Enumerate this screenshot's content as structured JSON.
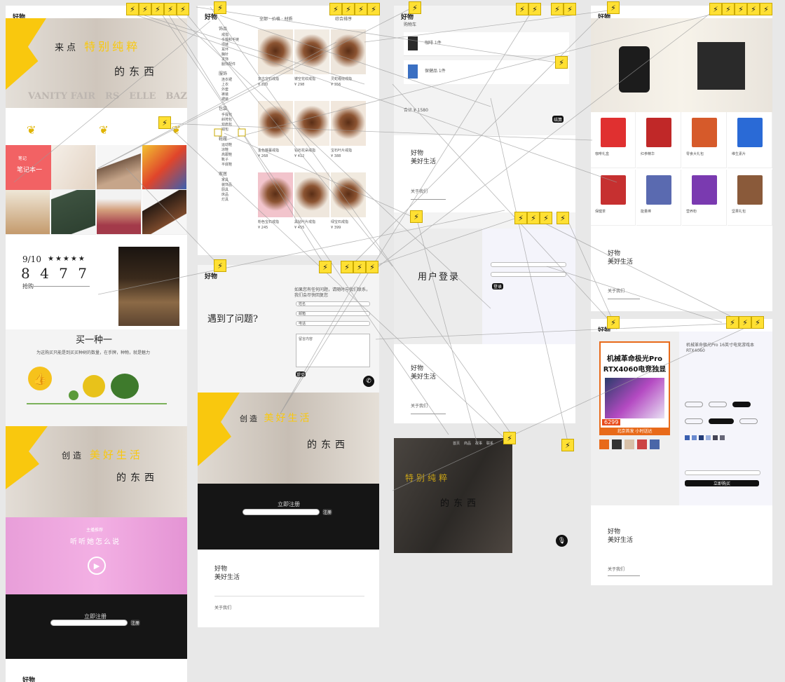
{
  "artboard1": {
    "header": "好物",
    "hero": {
      "line1_a": "来点",
      "line1_b": "特别纯粹",
      "line2": "的东西"
    },
    "brands": [
      "VANITY FAIR",
      "RS",
      "ELLE",
      "BAZAAR"
    ],
    "notebook": {
      "small": "笔记",
      "label": "笔记本一"
    },
    "deal": {
      "date": "9/10",
      "stars": "★★★★★",
      "count": "8 4 7 7",
      "label": "抢购"
    },
    "buy_one": {
      "title": "买一种一",
      "desc": "为这购买只能是到买买种树的数量，在手牌，种物，就是魅力"
    },
    "hero2": {
      "line1_a": "创造",
      "line1_b": "美好生活",
      "line2": "的东西"
    },
    "video": {
      "small": "主播推荐",
      "title": "听听她怎么说"
    },
    "subscribe": {
      "title": "立即注册",
      "button": "注册"
    },
    "footer": "好物"
  },
  "artboard2": {
    "header": "好物",
    "sidebar_groups": [
      {
        "title": "饰品",
        "items": [
          "戒指",
          "手镯和手链",
          "项链",
          "耳环",
          "胸针",
          "发饰",
          "服饰配件"
        ]
      },
      {
        "title": "服饰",
        "items": [
          "连衣裙",
          "上衣",
          "外套",
          "裤装",
          "裙装"
        ]
      },
      {
        "title": "包袋",
        "items": [
          "手提包",
          "斜挎包",
          "双肩包",
          "钱包"
        ]
      },
      {
        "title": "鞋履",
        "items": [
          "运动鞋",
          "凉鞋",
          "高跟鞋",
          "靴子",
          "平底鞋"
        ]
      },
      {
        "title": "家居",
        "items": [
          "家具",
          "装饰品",
          "厨具",
          "床品",
          "灯具"
        ]
      }
    ],
    "top_filter": "全部 · 价格 · 材质",
    "sort_label": "综合排序",
    "products": [
      {
        "name": "复古宝石戒指",
        "price": "¥ 320"
      },
      {
        "name": "镂空花纹戒指",
        "price": "¥ 298"
      },
      {
        "name": "灵蛇缠绕戒指",
        "price": "¥ 356"
      },
      {
        "name": "金色藤蔓戒指",
        "price": "¥ 268"
      },
      {
        "name": "钻石花朵戒指",
        "price": "¥ 412"
      },
      {
        "name": "宝石叶片戒指",
        "price": "¥ 388"
      },
      {
        "name": "粉色宝石戒指",
        "price": "¥ 245"
      },
      {
        "name": "黑钻叶片戒指",
        "price": "¥ 455"
      },
      {
        "name": "绿宝石戒指",
        "price": "¥ 399"
      }
    ]
  },
  "artboard3": {
    "header": "好物",
    "cart": {
      "title": "购物车",
      "items": [
        "咖啡 1件",
        "保健品 1件"
      ],
      "total": "合计 ¥ 1580",
      "checkout": "结算"
    },
    "footer": {
      "title": "好物",
      "subtitle": "美好生活",
      "link": "关于我们"
    },
    "login": {
      "title": "用户登录",
      "button": "登录"
    },
    "footer2": {
      "title": "好物",
      "subtitle": "美好生活",
      "link": "关于我们"
    }
  },
  "artboard4": {
    "header": "好物",
    "contact": {
      "title": "遇到了问题?",
      "intro": "如果您有任何问题，请随时与我们联系，我们会尽快回复您",
      "fields": [
        "姓名",
        "邮箱",
        "电话"
      ],
      "message": "留言内容",
      "button": "提交"
    },
    "hero": {
      "line1_a": "创造",
      "line1_b": "美好生活",
      "line2": "的东西"
    },
    "subscribe": {
      "title": "立即注册",
      "button": "注册"
    },
    "footer": {
      "title": "好物",
      "subtitle": "美好生活",
      "link": "关于我们"
    }
  },
  "artboard5": {
    "nav": [
      "首页",
      "商品",
      "故事",
      "联系"
    ],
    "hero": {
      "line1": "特别纯粹",
      "line2": "的东西"
    }
  },
  "artboard6": {
    "header": "好物",
    "products": [
      "咖啡礼盒",
      "红参精华",
      "零食大礼包",
      "维生素片",
      "保健茶",
      "能量棒",
      "营养粉",
      "坚果礼包"
    ],
    "footer": {
      "title": "好物",
      "subtitle": "美好生活",
      "link": "关于我们"
    }
  },
  "artboard7": {
    "header": "好物",
    "ad": {
      "line1": "机械革命极光Pro",
      "line2": "RTX4060电竞独显",
      "price": "6299",
      "tag": "北京首发 小时送达"
    },
    "title": "机械革命极光Pro 16英寸电竞游戏本 RTX4060",
    "buy_button": "立即购买",
    "footer": {
      "title": "好物",
      "subtitle": "美好生活",
      "link": "关于我们"
    }
  }
}
